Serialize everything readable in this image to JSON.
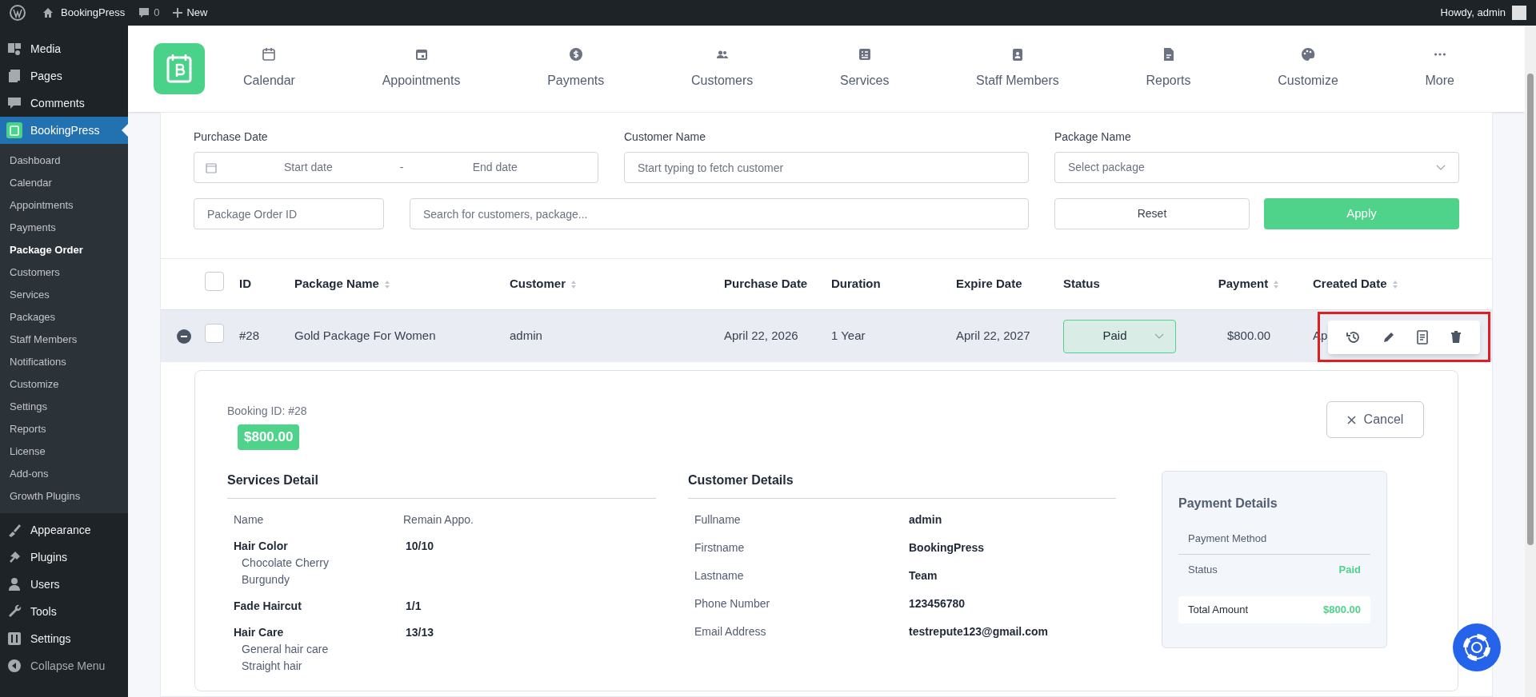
{
  "admin_bar": {
    "site": "BookingPress",
    "comments": "0",
    "new": "New",
    "greeting": "Howdy, admin"
  },
  "sidebar": {
    "items": [
      {
        "label": "Media",
        "selected": false
      },
      {
        "label": "Pages",
        "selected": false
      },
      {
        "label": "Comments",
        "selected": false
      },
      {
        "label": "BookingPress",
        "selected": true,
        "children": [
          {
            "label": "Dashboard",
            "selected": false
          },
          {
            "label": "Calendar",
            "selected": false
          },
          {
            "label": "Appointments",
            "selected": false
          },
          {
            "label": "Payments",
            "selected": false
          },
          {
            "label": "Package Order",
            "selected": true
          },
          {
            "label": "Customers",
            "selected": false
          },
          {
            "label": "Services",
            "selected": false
          },
          {
            "label": "Packages",
            "selected": false
          },
          {
            "label": "Staff Members",
            "selected": false
          },
          {
            "label": "Notifications",
            "selected": false
          },
          {
            "label": "Customize",
            "selected": false
          },
          {
            "label": "Settings",
            "selected": false
          },
          {
            "label": "Reports",
            "selected": false
          },
          {
            "label": "License",
            "selected": false
          },
          {
            "label": "Add-ons",
            "selected": false
          },
          {
            "label": "Growth Plugins",
            "selected": false
          }
        ]
      },
      {
        "label": "Appearance",
        "selected": false
      },
      {
        "label": "Plugins",
        "selected": false
      },
      {
        "label": "Users",
        "selected": false
      },
      {
        "label": "Tools",
        "selected": false
      },
      {
        "label": "Settings",
        "selected": false
      },
      {
        "label": "Collapse Menu",
        "selected": false
      }
    ]
  },
  "nav": {
    "items": [
      {
        "label": "Calendar"
      },
      {
        "label": "Appointments"
      },
      {
        "label": "Payments"
      },
      {
        "label": "Customers"
      },
      {
        "label": "Services"
      },
      {
        "label": "Staff Members"
      },
      {
        "label": "Reports"
      },
      {
        "label": "Customize"
      },
      {
        "label": "More"
      }
    ]
  },
  "filters": {
    "purchase_date": {
      "label": "Purchase Date",
      "start": "Start date",
      "separator": "-",
      "end": "End date"
    },
    "customer_name": {
      "label": "Customer Name",
      "placeholder": "Start typing to fetch customer"
    },
    "package_name": {
      "label": "Package Name",
      "placeholder": "Select package"
    },
    "package_order_id": {
      "placeholder": "Package Order ID"
    },
    "search": {
      "placeholder": "Search for customers, package..."
    },
    "reset": "Reset",
    "apply": "Apply"
  },
  "table": {
    "columns": [
      {
        "label": "ID",
        "sortable": false
      },
      {
        "label": "Package Name",
        "sortable": true
      },
      {
        "label": "Customer",
        "sortable": true
      },
      {
        "label": "Purchase Date",
        "sortable": false
      },
      {
        "label": "Duration",
        "sortable": false
      },
      {
        "label": "Expire Date",
        "sortable": false
      },
      {
        "label": "Status",
        "sortable": false
      },
      {
        "label": "Payment",
        "sortable": true
      },
      {
        "label": "Created Date",
        "sortable": true
      }
    ],
    "header_checked": false,
    "rows": [
      {
        "expanded": true,
        "checked": false,
        "id": "#28",
        "package_name": "Gold Package For Women",
        "customer": "admin",
        "purchase_date": "April 22, 2026",
        "duration": "1 Year",
        "expire_date": "April 22, 2027",
        "status": "Paid",
        "payment": "$800.00",
        "created_date": "Ap",
        "actions_highlighted": true,
        "detail": {
          "booking_id": "Booking ID: #28",
          "amount": "$800.00",
          "cancel": "Cancel",
          "services": {
            "heading": "Services Detail",
            "columns": [
              "Name",
              "Remain Appo."
            ],
            "items": [
              {
                "name": "Hair Color",
                "extras": [
                  "Chocolate Cherry",
                  "Burgundy"
                ],
                "remain": "10/10"
              },
              {
                "name": "Fade Haircut",
                "remain": "1/1"
              },
              {
                "name": "Hair Care",
                "extras": [
                  "General hair care",
                  "Straight hair"
                ],
                "remain": "13/13"
              }
            ]
          },
          "customer": {
            "heading": "Customer Details",
            "fields": [
              {
                "label": "Fullname",
                "value": "admin"
              },
              {
                "label": "Firstname",
                "value": "BookingPress"
              },
              {
                "label": "Lastname",
                "value": "Team"
              },
              {
                "label": "Phone Number",
                "value": "123456780"
              },
              {
                "label": "Email Address",
                "value": "testrepute123@gmail.com"
              }
            ]
          },
          "payment": {
            "heading": "Payment Details",
            "rows": [
              {
                "kind": "plain",
                "label": "Payment Method"
              },
              {
                "kind": "status",
                "label": "Status",
                "value": "Paid"
              },
              {
                "kind": "total",
                "label": "Total Amount",
                "value": "$800.00"
              }
            ]
          }
        }
      }
    ]
  }
}
